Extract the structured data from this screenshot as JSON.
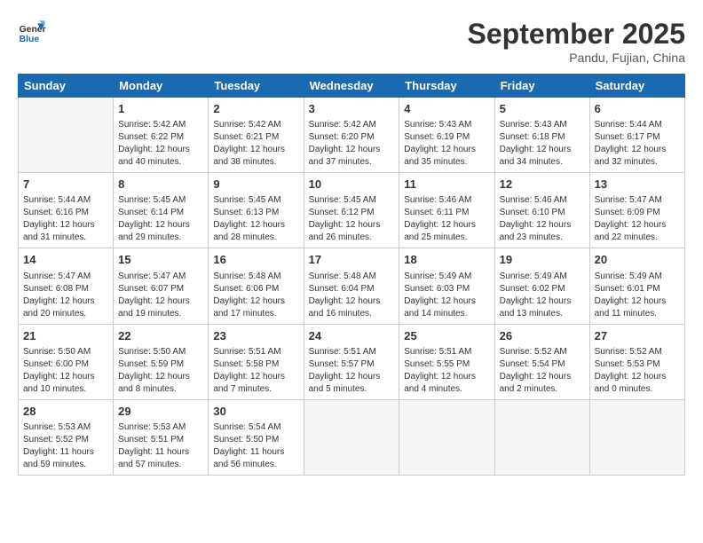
{
  "header": {
    "logo_line1": "General",
    "logo_line2": "Blue",
    "month": "September 2025",
    "location": "Pandu, Fujian, China"
  },
  "weekdays": [
    "Sunday",
    "Monday",
    "Tuesday",
    "Wednesday",
    "Thursday",
    "Friday",
    "Saturday"
  ],
  "weeks": [
    [
      {
        "day": "",
        "empty": true,
        "lines": []
      },
      {
        "day": "1",
        "empty": false,
        "lines": [
          "Sunrise: 5:42 AM",
          "Sunset: 6:22 PM",
          "Daylight: 12 hours",
          "and 40 minutes."
        ]
      },
      {
        "day": "2",
        "empty": false,
        "lines": [
          "Sunrise: 5:42 AM",
          "Sunset: 6:21 PM",
          "Daylight: 12 hours",
          "and 38 minutes."
        ]
      },
      {
        "day": "3",
        "empty": false,
        "lines": [
          "Sunrise: 5:42 AM",
          "Sunset: 6:20 PM",
          "Daylight: 12 hours",
          "and 37 minutes."
        ]
      },
      {
        "day": "4",
        "empty": false,
        "lines": [
          "Sunrise: 5:43 AM",
          "Sunset: 6:19 PM",
          "Daylight: 12 hours",
          "and 35 minutes."
        ]
      },
      {
        "day": "5",
        "empty": false,
        "lines": [
          "Sunrise: 5:43 AM",
          "Sunset: 6:18 PM",
          "Daylight: 12 hours",
          "and 34 minutes."
        ]
      },
      {
        "day": "6",
        "empty": false,
        "lines": [
          "Sunrise: 5:44 AM",
          "Sunset: 6:17 PM",
          "Daylight: 12 hours",
          "and 32 minutes."
        ]
      }
    ],
    [
      {
        "day": "7",
        "empty": false,
        "lines": [
          "Sunrise: 5:44 AM",
          "Sunset: 6:16 PM",
          "Daylight: 12 hours",
          "and 31 minutes."
        ]
      },
      {
        "day": "8",
        "empty": false,
        "lines": [
          "Sunrise: 5:45 AM",
          "Sunset: 6:14 PM",
          "Daylight: 12 hours",
          "and 29 minutes."
        ]
      },
      {
        "day": "9",
        "empty": false,
        "lines": [
          "Sunrise: 5:45 AM",
          "Sunset: 6:13 PM",
          "Daylight: 12 hours",
          "and 28 minutes."
        ]
      },
      {
        "day": "10",
        "empty": false,
        "lines": [
          "Sunrise: 5:45 AM",
          "Sunset: 6:12 PM",
          "Daylight: 12 hours",
          "and 26 minutes."
        ]
      },
      {
        "day": "11",
        "empty": false,
        "lines": [
          "Sunrise: 5:46 AM",
          "Sunset: 6:11 PM",
          "Daylight: 12 hours",
          "and 25 minutes."
        ]
      },
      {
        "day": "12",
        "empty": false,
        "lines": [
          "Sunrise: 5:46 AM",
          "Sunset: 6:10 PM",
          "Daylight: 12 hours",
          "and 23 minutes."
        ]
      },
      {
        "day": "13",
        "empty": false,
        "lines": [
          "Sunrise: 5:47 AM",
          "Sunset: 6:09 PM",
          "Daylight: 12 hours",
          "and 22 minutes."
        ]
      }
    ],
    [
      {
        "day": "14",
        "empty": false,
        "lines": [
          "Sunrise: 5:47 AM",
          "Sunset: 6:08 PM",
          "Daylight: 12 hours",
          "and 20 minutes."
        ]
      },
      {
        "day": "15",
        "empty": false,
        "lines": [
          "Sunrise: 5:47 AM",
          "Sunset: 6:07 PM",
          "Daylight: 12 hours",
          "and 19 minutes."
        ]
      },
      {
        "day": "16",
        "empty": false,
        "lines": [
          "Sunrise: 5:48 AM",
          "Sunset: 6:06 PM",
          "Daylight: 12 hours",
          "and 17 minutes."
        ]
      },
      {
        "day": "17",
        "empty": false,
        "lines": [
          "Sunrise: 5:48 AM",
          "Sunset: 6:04 PM",
          "Daylight: 12 hours",
          "and 16 minutes."
        ]
      },
      {
        "day": "18",
        "empty": false,
        "lines": [
          "Sunrise: 5:49 AM",
          "Sunset: 6:03 PM",
          "Daylight: 12 hours",
          "and 14 minutes."
        ]
      },
      {
        "day": "19",
        "empty": false,
        "lines": [
          "Sunrise: 5:49 AM",
          "Sunset: 6:02 PM",
          "Daylight: 12 hours",
          "and 13 minutes."
        ]
      },
      {
        "day": "20",
        "empty": false,
        "lines": [
          "Sunrise: 5:49 AM",
          "Sunset: 6:01 PM",
          "Daylight: 12 hours",
          "and 11 minutes."
        ]
      }
    ],
    [
      {
        "day": "21",
        "empty": false,
        "lines": [
          "Sunrise: 5:50 AM",
          "Sunset: 6:00 PM",
          "Daylight: 12 hours",
          "and 10 minutes."
        ]
      },
      {
        "day": "22",
        "empty": false,
        "lines": [
          "Sunrise: 5:50 AM",
          "Sunset: 5:59 PM",
          "Daylight: 12 hours",
          "and 8 minutes."
        ]
      },
      {
        "day": "23",
        "empty": false,
        "lines": [
          "Sunrise: 5:51 AM",
          "Sunset: 5:58 PM",
          "Daylight: 12 hours",
          "and 7 minutes."
        ]
      },
      {
        "day": "24",
        "empty": false,
        "lines": [
          "Sunrise: 5:51 AM",
          "Sunset: 5:57 PM",
          "Daylight: 12 hours",
          "and 5 minutes."
        ]
      },
      {
        "day": "25",
        "empty": false,
        "lines": [
          "Sunrise: 5:51 AM",
          "Sunset: 5:55 PM",
          "Daylight: 12 hours",
          "and 4 minutes."
        ]
      },
      {
        "day": "26",
        "empty": false,
        "lines": [
          "Sunrise: 5:52 AM",
          "Sunset: 5:54 PM",
          "Daylight: 12 hours",
          "and 2 minutes."
        ]
      },
      {
        "day": "27",
        "empty": false,
        "lines": [
          "Sunrise: 5:52 AM",
          "Sunset: 5:53 PM",
          "Daylight: 12 hours",
          "and 0 minutes."
        ]
      }
    ],
    [
      {
        "day": "28",
        "empty": false,
        "lines": [
          "Sunrise: 5:53 AM",
          "Sunset: 5:52 PM",
          "Daylight: 11 hours",
          "and 59 minutes."
        ]
      },
      {
        "day": "29",
        "empty": false,
        "lines": [
          "Sunrise: 5:53 AM",
          "Sunset: 5:51 PM",
          "Daylight: 11 hours",
          "and 57 minutes."
        ]
      },
      {
        "day": "30",
        "empty": false,
        "lines": [
          "Sunrise: 5:54 AM",
          "Sunset: 5:50 PM",
          "Daylight: 11 hours",
          "and 56 minutes."
        ]
      },
      {
        "day": "",
        "empty": true,
        "lines": []
      },
      {
        "day": "",
        "empty": true,
        "lines": []
      },
      {
        "day": "",
        "empty": true,
        "lines": []
      },
      {
        "day": "",
        "empty": true,
        "lines": []
      }
    ]
  ]
}
